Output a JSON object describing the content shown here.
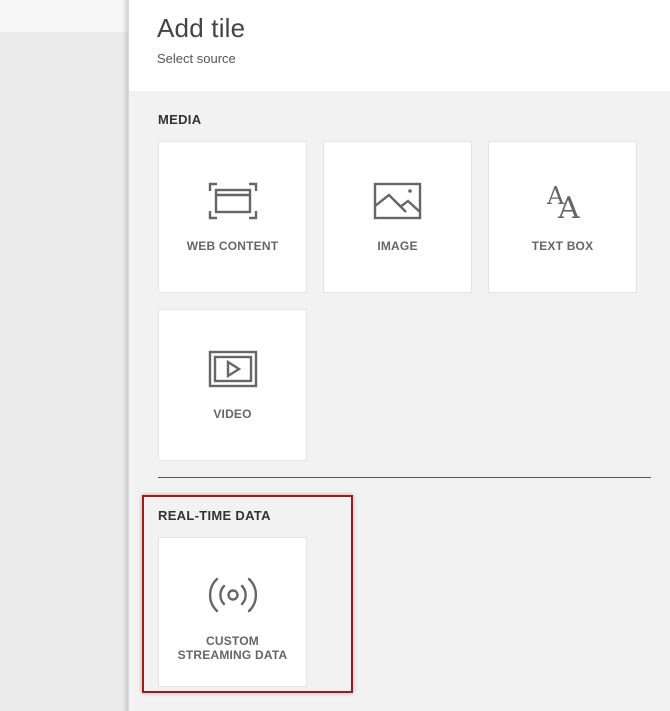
{
  "panel": {
    "title": "Add tile",
    "subtitle": "Select source"
  },
  "media": {
    "heading": "MEDIA",
    "tiles": [
      {
        "label": "WEB CONTENT",
        "icon": "web-content-icon"
      },
      {
        "label": "IMAGE",
        "icon": "image-icon"
      },
      {
        "label": "TEXT BOX",
        "icon": "text-box-icon"
      },
      {
        "label": "VIDEO",
        "icon": "video-icon"
      }
    ]
  },
  "realtime": {
    "heading": "REAL-TIME DATA",
    "tiles": [
      {
        "label_line1": "CUSTOM",
        "label_line2": "STREAMING DATA",
        "icon": "streaming-data-icon"
      }
    ]
  },
  "colors": {
    "highlight": "#9b1c1c",
    "icon": "#666666"
  }
}
